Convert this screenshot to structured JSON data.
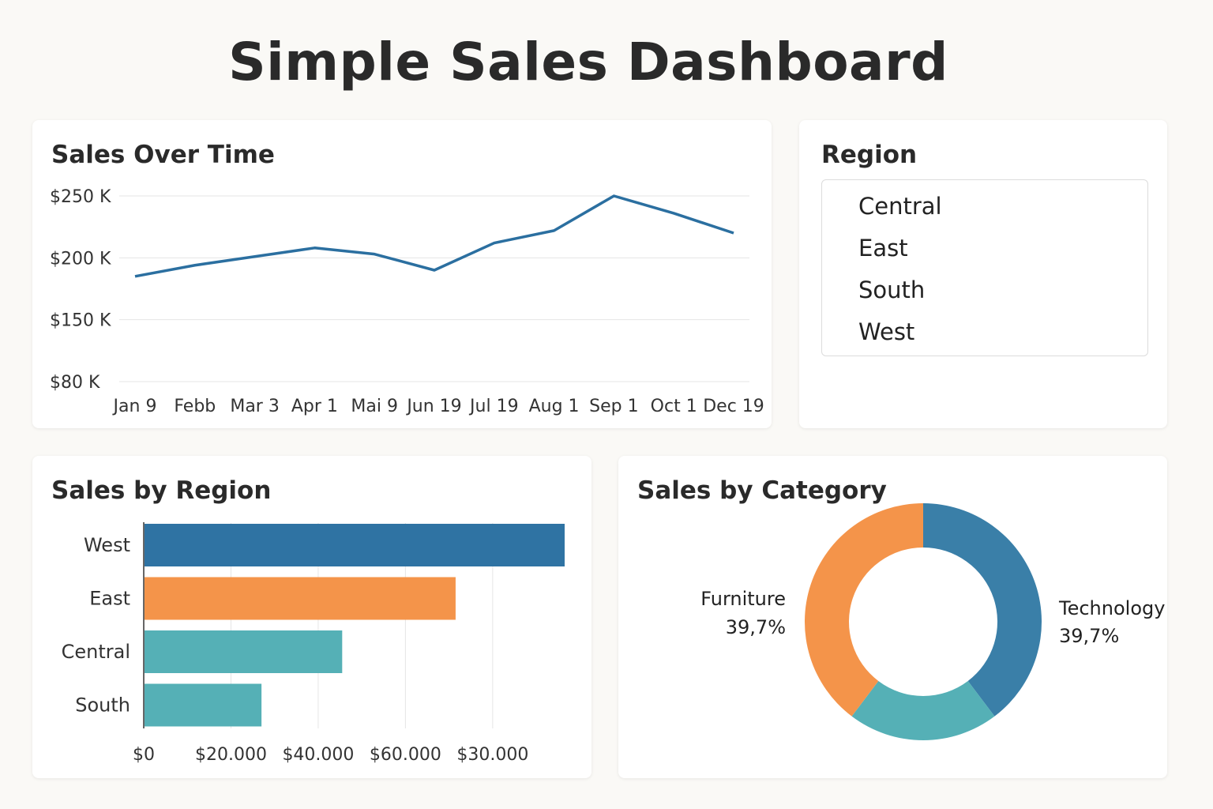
{
  "page": {
    "title": "Simple Sales Dashboard"
  },
  "line_card": {
    "title": "Sales Over Time"
  },
  "region_card": {
    "title": "Region",
    "items": [
      "Central",
      "East",
      "South",
      "West"
    ]
  },
  "bar_card": {
    "title": "Sales by Region"
  },
  "donut_card": {
    "title": "Sales by Category"
  },
  "colors": {
    "blue": "#2f73a3",
    "orange": "#f4944a",
    "teal": "#55b0b6",
    "line": "#2b6fa0"
  },
  "chart_data": [
    {
      "type": "line",
      "title": "Sales Over Time",
      "x": [
        "Jan 9",
        "Febb",
        "Mar 3",
        "Apr 1",
        "Mai 9",
        "Jun 19",
        "Jul 19",
        "Aug 1",
        "Sep 1",
        "Oct 1",
        "Dec 19"
      ],
      "y_tick_labels": [
        "$250 K",
        "$200 K",
        "$150 K",
        "$80 K"
      ],
      "y_tick_values": [
        250,
        200,
        150,
        100
      ],
      "series": [
        {
          "values": [
            185,
            194,
            201,
            208,
            203,
            190,
            212,
            222,
            250,
            236,
            220
          ]
        }
      ],
      "ylim": [
        100,
        250
      ],
      "grid": true
    },
    {
      "type": "bar",
      "orientation": "horizontal",
      "title": "Sales by Region",
      "categories": [
        "West",
        "East",
        "Central",
        "South"
      ],
      "values": [
        96500,
        71500,
        45500,
        27000
      ],
      "x_tick_labels": [
        "$0",
        "$20.000",
        "$40.000",
        "$60.000",
        "$30.000"
      ],
      "x_tick_values": [
        0,
        20000,
        40000,
        60000,
        80000
      ],
      "xlim": [
        0,
        100000
      ],
      "grid": true,
      "bar_colors": [
        "#2f73a3",
        "#f4944a",
        "#55b0b6",
        "#55b0b6"
      ]
    },
    {
      "type": "pie",
      "donut": true,
      "title": "Sales by Category",
      "slices": [
        {
          "label": "Technology",
          "value_label": "39,7%",
          "value": 39.7,
          "color": "#3a7fa8"
        },
        {
          "label": "",
          "value_label": "",
          "value": 20.6,
          "color": "#55b0b6"
        },
        {
          "label": "Furniture",
          "value_label": "39,7%",
          "value": 39.7,
          "color": "#f4944a"
        }
      ]
    }
  ]
}
